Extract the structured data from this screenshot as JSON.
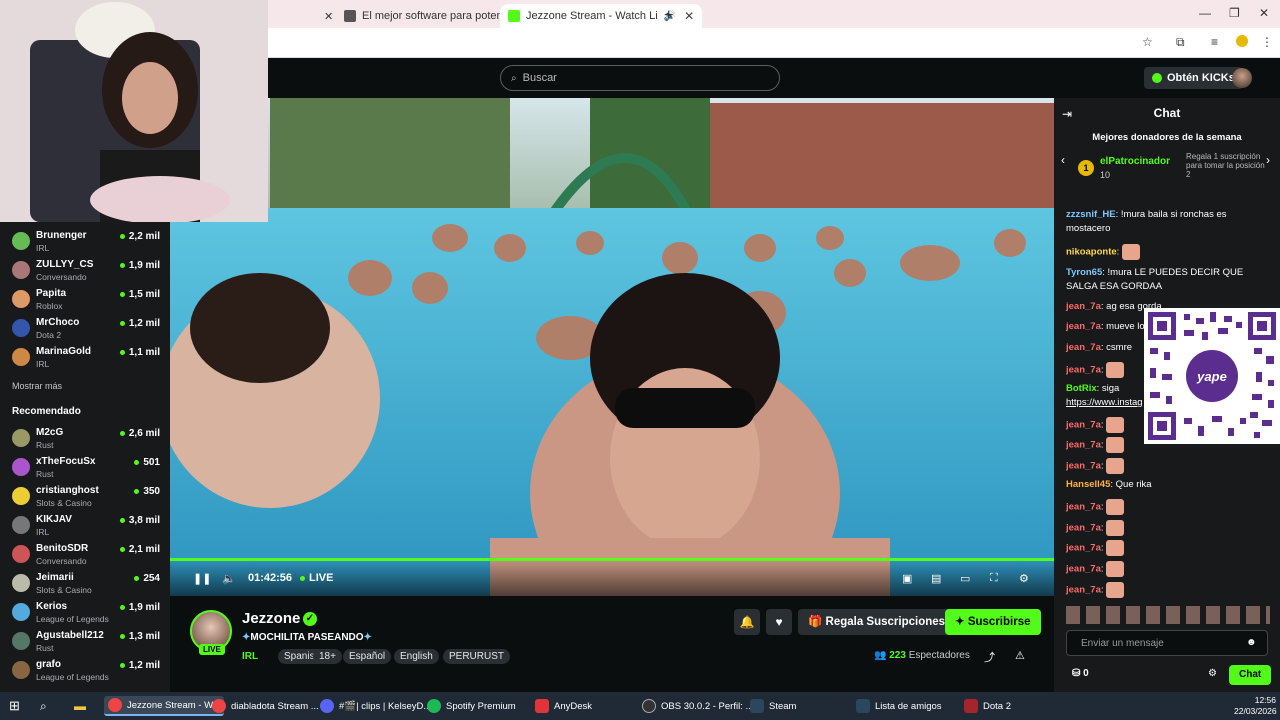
{
  "browser": {
    "tabs": [
      {
        "label": "El mejor software para potenci"
      },
      {
        "label": "Jezzone Stream - Watch Li"
      }
    ]
  },
  "header": {
    "search_placeholder": "Buscar",
    "get_kicks": "Obtén KICKs"
  },
  "sidebar": {
    "following": [
      {
        "name": "Brunenger",
        "category": "IRL",
        "viewers": "2,2 mil"
      },
      {
        "name": "ZULLYY_CS",
        "category": "Conversando",
        "viewers": "1,9 mil"
      },
      {
        "name": "Papita",
        "category": "Roblox",
        "viewers": "1,5 mil"
      },
      {
        "name": "MrChoco",
        "category": "Dota 2",
        "viewers": "1,2 mil"
      },
      {
        "name": "MarinaGold",
        "category": "IRL",
        "viewers": "1,1 mil"
      }
    ],
    "show_more": "Mostrar más",
    "recommended_title": "Recomendado",
    "recommended": [
      {
        "name": "M2cG",
        "category": "Rust",
        "viewers": "2,6 mil"
      },
      {
        "name": "xTheFocuSx",
        "category": "Rust",
        "viewers": "501"
      },
      {
        "name": "cristianghost",
        "category": "Slots & Casino",
        "viewers": "350"
      },
      {
        "name": "KIKJAV",
        "category": "IRL",
        "viewers": "3,8 mil"
      },
      {
        "name": "BenitoSDR",
        "category": "Conversando",
        "viewers": "2,1 mil"
      },
      {
        "name": "Jeimarii",
        "category": "Slots & Casino",
        "viewers": "254"
      },
      {
        "name": "Kerios",
        "category": "League of Legends",
        "viewers": "1,9 mil"
      },
      {
        "name": "Agustabell212",
        "category": "Rust",
        "viewers": "1,3 mil"
      },
      {
        "name": "grafo",
        "category": "League of Legends",
        "viewers": "1,2 mil"
      }
    ]
  },
  "player": {
    "time": "01:42:56",
    "live_label": "LIVE",
    "progress": 1.0
  },
  "channel": {
    "name": "Jezzone",
    "live_badge": "LIVE",
    "title": "MOCHILITA PASEANDO",
    "category": "IRL",
    "tags": [
      "Spanish",
      "18+",
      "Español",
      "English",
      "PERURUST"
    ],
    "gift_label": "Regala Suscripciones",
    "subscribe_label": "Suscribirse",
    "viewers_count": "223",
    "viewers_label": "Espectadores"
  },
  "chat": {
    "title": "Chat",
    "donors_title": "Mejores donadores de la semana",
    "donor_rank": "1",
    "donor_name": "elPatrocinador",
    "donor_count": "10",
    "donor_note": "Regala 1 suscripción para tomar la posición 2",
    "messages": [
      {
        "user": "zzzsnif_HE",
        "text": "!mura baila si ronchas es mostacero",
        "color": "#7ec8ff"
      },
      {
        "user": "nikoaponte",
        "text": "",
        "color": "#ffd84a"
      },
      {
        "user": "Tyron65",
        "text": "!mura LE PUEDES DECIR QUE SALGA ESA GORDAA",
        "color": "#7ec8ff"
      },
      {
        "user": "jean_7a",
        "text": "ag esa gorda",
        "color": "#ff6b6b"
      },
      {
        "user": "jean_7a",
        "text": "mueve los",
        "color": "#ff6b6b"
      },
      {
        "user": "jean_7a",
        "text": "csmre",
        "color": "#ff6b6b"
      },
      {
        "user": "jean_7a",
        "text": "",
        "color": "#ff6b6b"
      },
      {
        "user": "BotRix",
        "text": "siga",
        "color": "#53fc18"
      },
      {
        "user": "",
        "text": "https://www.instag",
        "color": "#ffffff"
      },
      {
        "user": "jean_7a",
        "text": "",
        "color": "#ff6b6b"
      },
      {
        "user": "jean_7a",
        "text": "",
        "color": "#ff6b6b"
      },
      {
        "user": "jean_7a",
        "text": "",
        "color": "#ff6b6b"
      },
      {
        "user": "Hansell45",
        "text": "Que rika",
        "color": "#ffb347"
      },
      {
        "user": "jean_7a",
        "text": "",
        "color": "#ff6b6b"
      },
      {
        "user": "jean_7a",
        "text": "",
        "color": "#ff6b6b"
      },
      {
        "user": "jean_7a",
        "text": "",
        "color": "#ff6b6b"
      },
      {
        "user": "jean_7a",
        "text": "",
        "color": "#ff6b6b"
      },
      {
        "user": "jean_7a",
        "text": "",
        "color": "#ff6b6b"
      }
    ],
    "input_placeholder": "Enviar un mensaje",
    "points": "0",
    "send_label": "Chat"
  },
  "qr": {
    "brand": "yape"
  },
  "taskbar": {
    "items": [
      {
        "label": "Jezzone Stream - W...",
        "color": "#e44"
      },
      {
        "label": "diabladota Stream ...",
        "color": "#e44"
      },
      {
        "label": "#🎬| clips | KelseyD...",
        "color": "#5865f2"
      },
      {
        "label": "Spotify Premium",
        "color": "#1db954"
      },
      {
        "label": "AnyDesk",
        "color": "#e2333a"
      },
      {
        "label": "OBS 30.0.2 - Perfil: ...",
        "color": "#333"
      },
      {
        "label": "Steam",
        "color": "#2a475e"
      },
      {
        "label": "Lista de amigos",
        "color": "#2a475e"
      },
      {
        "label": "Dota 2",
        "color": "#a4252c"
      }
    ],
    "time": "12:56",
    "date": "22/03/2026"
  },
  "colors": {
    "accent": "#53fc18",
    "chat_bg": "#18191b",
    "page_bg": "#0b0e0f"
  }
}
